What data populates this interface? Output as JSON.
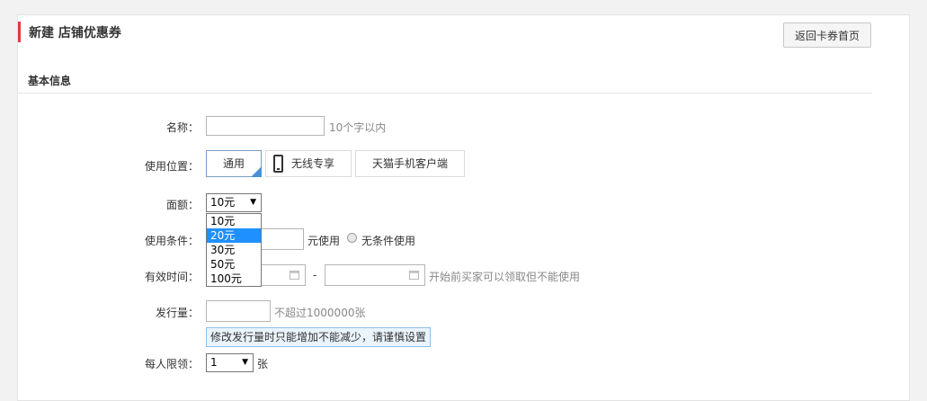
{
  "header": {
    "title": "新建 店铺优惠券",
    "back_label": "返回卡券首页"
  },
  "section": {
    "title": "基本信息"
  },
  "form": {
    "name": {
      "label": "名称：",
      "value": "",
      "hint": "10个字以内"
    },
    "position": {
      "label": "使用位置：",
      "options": [
        "通用",
        "无线专享",
        "天猫手机客户端"
      ],
      "selected": "通用"
    },
    "denomination": {
      "label": "面额：",
      "selected": "10元",
      "options": [
        "10元",
        "20元",
        "30元",
        "50元",
        "100元"
      ],
      "highlighted": "20元"
    },
    "condition": {
      "label": "使用条件：",
      "suffix": "元使用",
      "no_condition": "无条件使用"
    },
    "validity": {
      "label": "有效时间：",
      "separator": "-",
      "hint": "开始前买家可以领取但不能使用"
    },
    "quantity": {
      "label": "发行量：",
      "hint_prefix": "不超过",
      "hint_number": "1000000",
      "hint_suffix": "张",
      "tip": "修改发行量时只能增加不能减少，请谨慎设置"
    },
    "limit": {
      "label": "每人限领：",
      "selected": "1",
      "unit": "张"
    }
  },
  "colors": {
    "accent": "#e4393c",
    "highlight": "#1e90ff",
    "tip_bg": "#eaf4fd"
  }
}
